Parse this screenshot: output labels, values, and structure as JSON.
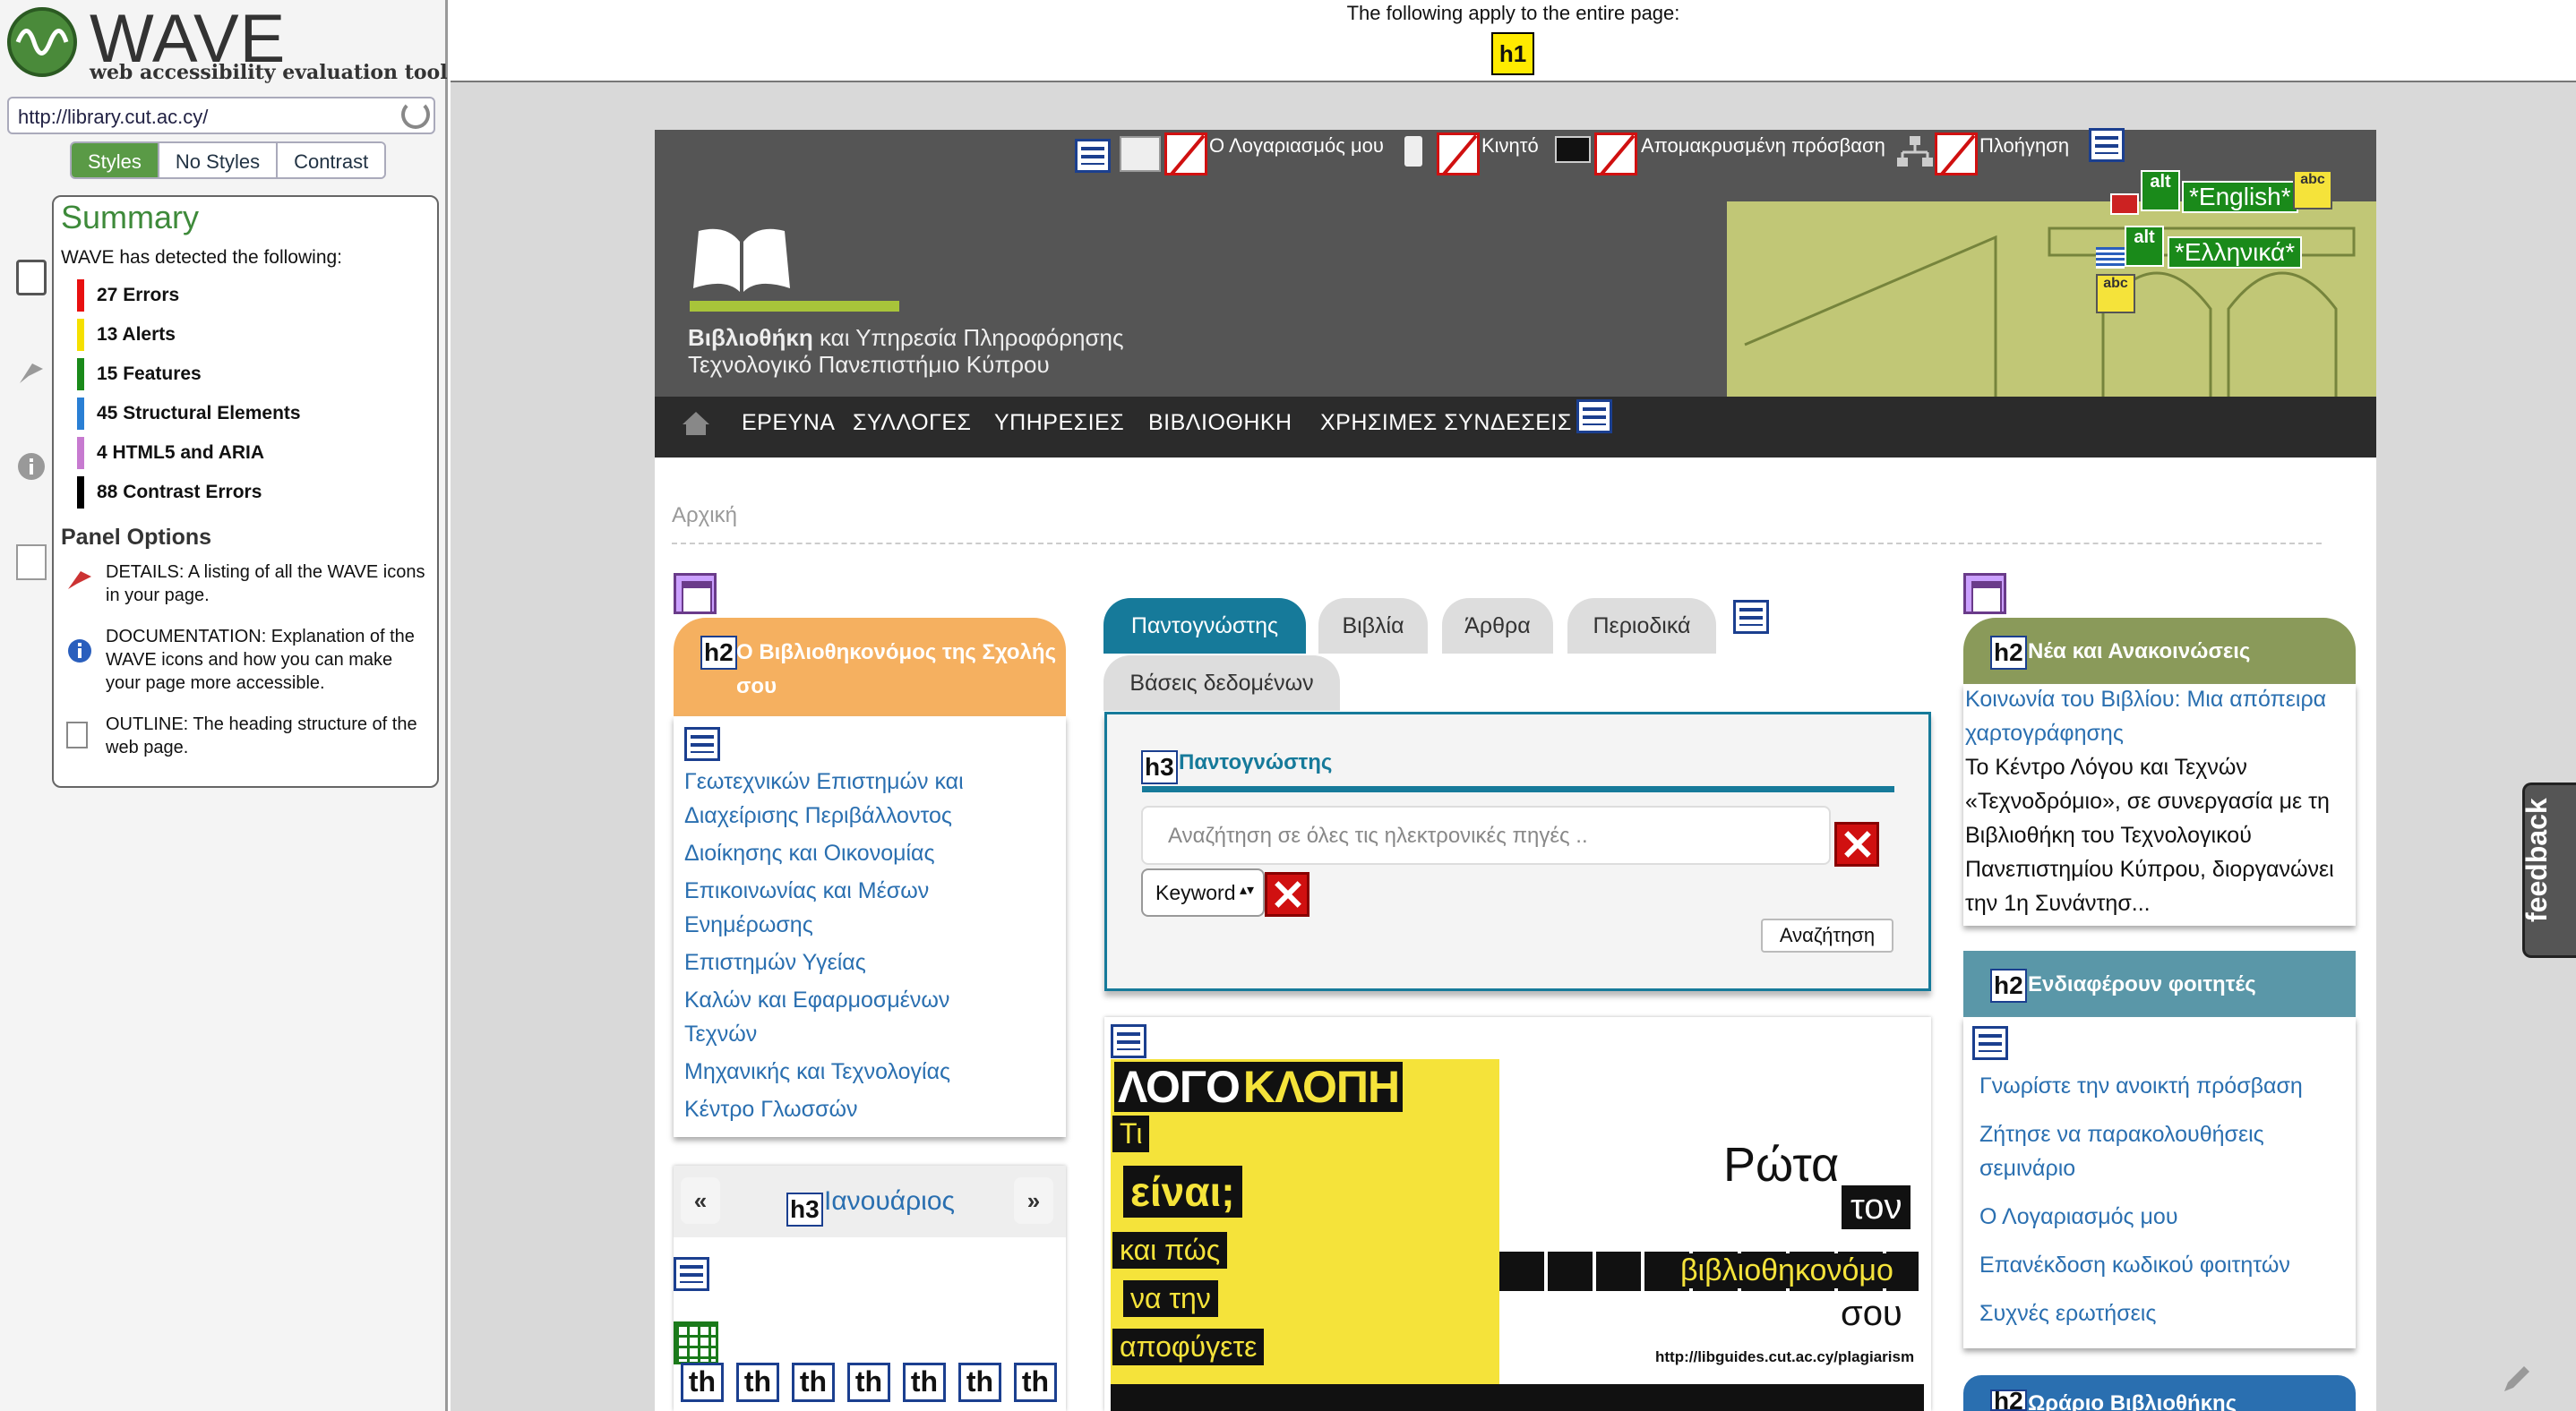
{
  "wave": {
    "logo": "WAVE",
    "tagline": "web accessibility evaluation tool",
    "url": "http://library.cut.ac.cy/",
    "view_tabs": [
      "Styles",
      "No Styles",
      "Contrast"
    ],
    "summary": {
      "title": "Summary",
      "detected": "WAVE has detected the following:",
      "counts": [
        {
          "label": "27 Errors",
          "color": "#e81010"
        },
        {
          "label": "13 Alerts",
          "color": "#f5e000"
        },
        {
          "label": "15 Features",
          "color": "#1a8a1a"
        },
        {
          "label": "45 Structural Elements",
          "color": "#2a7fd4"
        },
        {
          "label": "4 HTML5 and ARIA",
          "color": "#c77ad0"
        },
        {
          "label": "88 Contrast Errors",
          "color": "#000000"
        }
      ]
    },
    "panel_options": {
      "title": "Panel Options",
      "items": [
        "DETAILS: A listing of all the WAVE icons in your page.",
        "DOCUMENTATION: Explanation of the WAVE icons and how you can make your page more accessible.",
        "OUTLINE: The heading structure of the web page."
      ]
    },
    "top_note": "The following apply to the entire page:",
    "page_icon": "h1"
  },
  "site": {
    "utility": [
      "Ο Λογαριασμός μου",
      "Κινητό",
      "Απομακρυσμένη πρόσβαση",
      "Πλοήγηση"
    ],
    "languages": [
      "*English*",
      "*Ελληνικά*"
    ],
    "banner_line1_bold": "Βιβλιοθήκη",
    "banner_line1_rest": " και Υπηρεσία Πληροφόρησης",
    "banner_line2": "Τεχνολογικό Πανεπιστήμιο Κύπρου",
    "nav": [
      "ΕΡΕΥΝΑ",
      "ΣΥΛΛΟΓΕΣ",
      "ΥΠΗΡΕΣΙΕΣ",
      "ΒΙΒΛΙΟΘΗΚΗ",
      "ΧΡΗΣΙΜΕΣ ΣΥΝΔΕΣΕΙΣ"
    ],
    "breadcrumb": "Αρχική",
    "left": {
      "heading": "Ο Βιβλιοθηκονόμος της Σχολής σου",
      "links": [
        "Γεωτεχνικών Επιστημών και",
        "Διαχείρισης Περιβάλλοντος",
        "Διοίκησης και Οικονομίας",
        "Επικοινωνίας και Μέσων",
        "Ενημέρωσης",
        "Επιστημών Υγείας",
        "Καλών και Εφαρμοσμένων",
        "Τεχνών",
        "Μηχανικής και Τεχνολογίας",
        "Κέντρο Γλωσσών"
      ],
      "cal_prev": "«",
      "cal_next": "»",
      "month": "Ιανουάριος",
      "th": [
        "th",
        "th",
        "th",
        "th",
        "th",
        "th",
        "th"
      ]
    },
    "center": {
      "tabs": [
        "Παντογνώστης",
        "Βιβλία",
        "Άρθρα",
        "Περιοδικά",
        "Βάσεις δεδομένων"
      ],
      "search_title": "Παντογνώστης",
      "search_placeholder": "Αναζήτηση σε όλες τις ηλεκτρονικές πηγές ..",
      "select_value": "Keyword",
      "search_button": "Αναζήτηση",
      "promo": {
        "title_a": "ΛΟΓΟ",
        "title_b": "ΚΛΟΠΗ",
        "tags": [
          "Τι",
          "είναι;",
          "και πώς",
          "να την",
          "αποφύγετε"
        ],
        "rota": "Ρώτα",
        "ton": "τον",
        "bib": "βιβλιοθηκονόμο",
        "sou": "σου",
        "url": "http://libguides.cut.ac.cy/plagiarism"
      }
    },
    "right": {
      "news_heading": "Νέα και Ανακοινώσεις",
      "news_link": "Κοινωνία του Βιβλίου: Μια απόπειρα χαρτογράφησης",
      "news_text": "Το Κέντρο Λόγου και Τεχνών «Τεχνοδρόμιο», σε συνεργασία με τη Βιβλιοθήκη του Τεχνολογικού Πανεπιστημίου Κύπρου, διοργανώνει την 1η Συνάντησ...",
      "students_heading": "Ενδιαφέρουν φοιτητές",
      "students_links": [
        "Γνωρίστε την ανοικτή πρόσβαση",
        "Ζήτησε να παρακολουθήσεις σεμινάριο",
        "Ο Λογαριασμός μου",
        "Επανέκδοση κωδικού φοιτητών",
        "Συχνές ερωτήσεις"
      ],
      "hours_heading": "Ωράριο Βιβλιοθήκης"
    },
    "feedback": "feedback",
    "h2": "h2",
    "h3": "h3",
    "alt": "alt",
    "abc": "abc"
  }
}
